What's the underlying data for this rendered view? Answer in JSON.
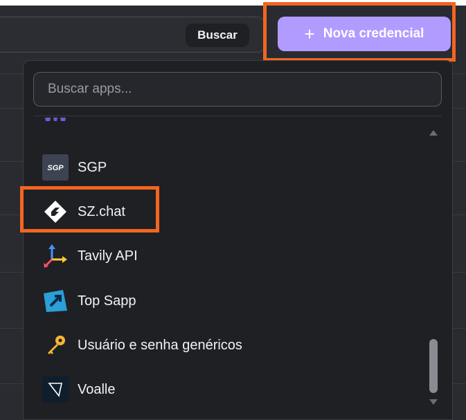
{
  "header": {
    "search_button_label": "Buscar",
    "new_credential_label": "Nova credencial",
    "new_credential_plus": "+"
  },
  "dropdown": {
    "search_placeholder": "Buscar apps...",
    "items": [
      {
        "label": "",
        "icon": "partially-visible-app-icon"
      },
      {
        "label": "SGP",
        "icon": "sgp-icon"
      },
      {
        "label": "SZ.chat",
        "icon": "szchat-icon"
      },
      {
        "label": "Tavily API",
        "icon": "tavily-icon"
      },
      {
        "label": "Top Sapp",
        "icon": "topsapp-icon"
      },
      {
        "label": "Usuário e senha genéricos",
        "icon": "key-icon"
      },
      {
        "label": "Voalle",
        "icon": "voalle-icon"
      }
    ],
    "sgp_icon_text": "SGP"
  },
  "colors": {
    "accent_button": "#b29bff",
    "highlight": "#f26522",
    "dropdown_bg": "#1f2024"
  }
}
